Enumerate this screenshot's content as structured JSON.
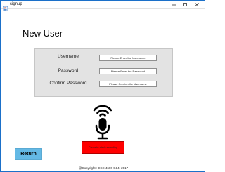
{
  "window": {
    "title": "signup",
    "icon": "java-app-icon",
    "controls": [
      "minimize-icon",
      "maximize-icon",
      "close-icon"
    ]
  },
  "page": {
    "title": "New User"
  },
  "form": {
    "username_label": "Username",
    "username_placeholder": "Please Enter the Username",
    "password_label": "Password",
    "password_placeholder": "Please Enter the Password",
    "confirm_label": "Confirm Password",
    "confirm_placeholder": "Please Confirm the Username"
  },
  "voice": {
    "icon": "microphone-icon",
    "record_label": "Press to start recording",
    "record_color": "#ff0000"
  },
  "footer": {
    "return_label": "Return",
    "return_color": "#64b9e5",
    "copyright": "@Copyright : ECE 4600 G14, 2017"
  }
}
